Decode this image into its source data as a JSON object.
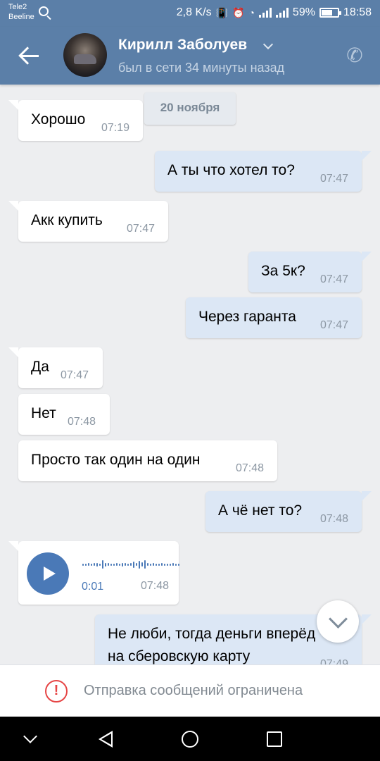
{
  "status_bar": {
    "carrier_1": "Tele2",
    "carrier_2": "Beeline",
    "speed": "2,8 K/s",
    "battery": "59%",
    "time": "18:58"
  },
  "header": {
    "contact_name": "Кирилл Заболуев",
    "last_seen": "был в сети 34 минуты назад"
  },
  "chat": {
    "date_label": "20 ноября",
    "messages": [
      {
        "text": "Хорошо",
        "time": "07:19",
        "direction": "in"
      },
      {
        "text": "А ты что хотел то?",
        "time": "07:47",
        "direction": "out"
      },
      {
        "text": "Акк купить",
        "time": "07:47",
        "direction": "in"
      },
      {
        "text": "За 5к?",
        "time": "07:47",
        "direction": "out"
      },
      {
        "text": "Через гаранта",
        "time": "07:47",
        "direction": "out"
      },
      {
        "text": "Да",
        "time": "07:47",
        "direction": "in"
      },
      {
        "text": "Нет",
        "time": "07:48",
        "direction": "in"
      },
      {
        "text": "Просто так один на один",
        "time": "07:48",
        "direction": "in"
      },
      {
        "text": "А чё нет то?",
        "time": "07:48",
        "direction": "out"
      },
      {
        "voice_duration": "0:01",
        "time": "07:48",
        "direction": "in"
      },
      {
        "text_line_1": "Не люби, тогда деньги вперёд",
        "text_line_2": "на сберовскую карту",
        "time": "07:49",
        "direction": "out"
      }
    ]
  },
  "restriction": {
    "text": "Отправка сообщений ограничена",
    "icon": "!"
  },
  "colors": {
    "header": "#5B7FA8",
    "incoming_bubble": "#FFFFFF",
    "outgoing_bubble": "#DCE7F5",
    "background": "#EDEEF0",
    "warning": "#E64646"
  }
}
